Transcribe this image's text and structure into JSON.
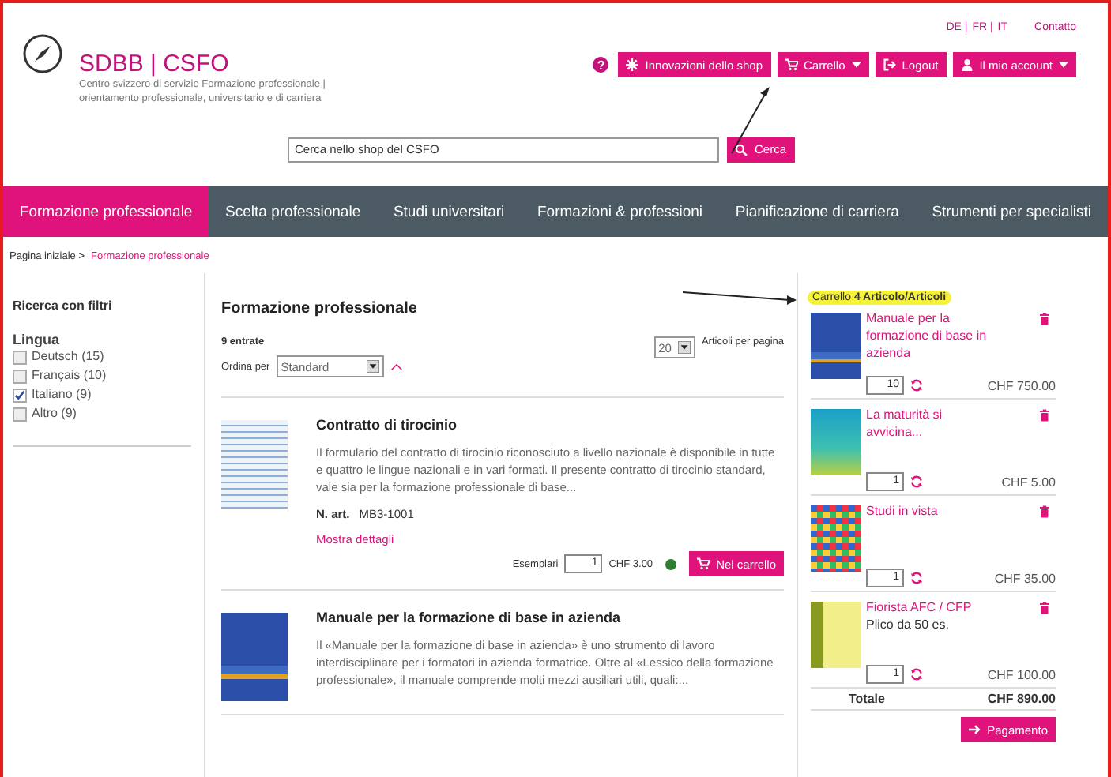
{
  "top_links": {
    "languages": [
      "DE |",
      "FR |",
      "IT"
    ],
    "contact": "Contatto"
  },
  "logo": {
    "title": "SDBB | CSFO",
    "subtitle": [
      "Centro svizzero di servizio Formazione professionale |",
      "orientamento professionale, universitario e di carriera"
    ]
  },
  "help": "?",
  "account_buttons": [
    {
      "label": "Innovazioni dello shop",
      "kind": "star",
      "dropdown": false
    },
    {
      "label": "Carrello",
      "kind": "cart",
      "dropdown": true
    },
    {
      "label": "Logout",
      "kind": "logout",
      "dropdown": false
    },
    {
      "label": "Il mio account",
      "kind": "user",
      "dropdown": true
    }
  ],
  "search": {
    "placeholder": "Cerca nello shop del CSFO",
    "button": "Cerca"
  },
  "nav": [
    {
      "label": "Formazione professionale",
      "selected": true
    },
    {
      "label": "Scelta professionale",
      "selected": false
    },
    {
      "label": "Studi universitari",
      "selected": false
    },
    {
      "label": "Formazioni & professioni",
      "selected": false
    },
    {
      "label": "Pianificazione di carriera",
      "selected": false
    },
    {
      "label": "Strumenti per specialisti",
      "selected": false
    }
  ],
  "breadcrumb": [
    "Pagina iniziale >",
    "Formazione professionale"
  ],
  "filters": {
    "title": "Ricerca con filtri",
    "group": "Lingua",
    "options": [
      {
        "label": "Deutsch (15)",
        "checked": false
      },
      {
        "label": "Français (10)",
        "checked": false
      },
      {
        "label": "Italiano (9)",
        "checked": true
      },
      {
        "label": "Altro (9)",
        "checked": false
      }
    ]
  },
  "list": {
    "title": "Formazione professionale",
    "count": "9 entrate",
    "sort_label": "Ordina per",
    "sort_value": "Standard",
    "per_page": "20",
    "per_page_label": "Articoli per pagina"
  },
  "products": [
    {
      "title": "Contratto di tirocinio",
      "kind": "form",
      "description": "Il formulario del contratto di tirocinio riconosciuto a livello nazionale è disponibile in tutte e quattro le lingue nazionali e in vari formati. Il presente contratto di tirocinio standard, vale sia per la formazione professionale di base...",
      "art_label": "N. art.",
      "art_number": "MB3-1001",
      "details": "Mostra dettagli",
      "qty_label": "Esemplari",
      "qty": "1",
      "price": "CHF 3.00",
      "color": "#2e7d32",
      "cart_button": "Nel carrello"
    },
    {
      "title": "Manuale per la formazione di base in azienda",
      "kind": "binder",
      "description": "Il «Manuale per la formazione di base in azienda» è uno strumento di lavoro interdisciplinare per i formatori in azienda formatrice. Oltre al «Lessico della formazione professionale», il manuale comprende molti mezzi ausiliari utili, quali:..."
    }
  ],
  "cart": {
    "title": "Carrello **4 Articolo/Articoli**",
    "items": [
      {
        "title": "Manuale per la formazione di base in azienda",
        "kind": "binder",
        "qty": "10",
        "price": "CHF 750.00"
      },
      {
        "title": "La maturità si avvicina...",
        "kind": "booklet",
        "qty": "1",
        "price": "CHF 5.00"
      },
      {
        "title": "Studi in vista",
        "kind": "mosaic",
        "qty": "1",
        "price": "CHF 35.00"
      },
      {
        "title": "Fiorista AFC / CFP",
        "subtitle": "Plico da 50 es.",
        "kind": "folder",
        "qty": "1",
        "price": "CHF 100.00"
      }
    ],
    "total_label": "Totale",
    "total": "CHF 890.00",
    "checkout": "Pagamento"
  }
}
